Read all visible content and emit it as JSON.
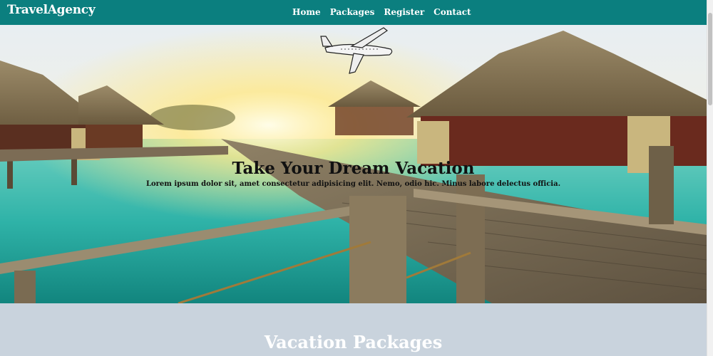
{
  "nav": {
    "brand": "TravelAgency",
    "links": [
      "Home",
      "Packages",
      "Register",
      "Contact"
    ]
  },
  "hero": {
    "title": "Take Your Dream Vacation",
    "text": "Lorem ipsum dolor sit, amet consectetur adipisicing elit. Nemo, odio hic. Minus labore delectus officia."
  },
  "packages": {
    "title": "Vacation Packages"
  },
  "colors": {
    "navbar": "#0b7f7f",
    "section_bg": "#c9d3dd",
    "water": "#2fb3a8"
  },
  "icons": {
    "plane": "airplane-icon"
  }
}
